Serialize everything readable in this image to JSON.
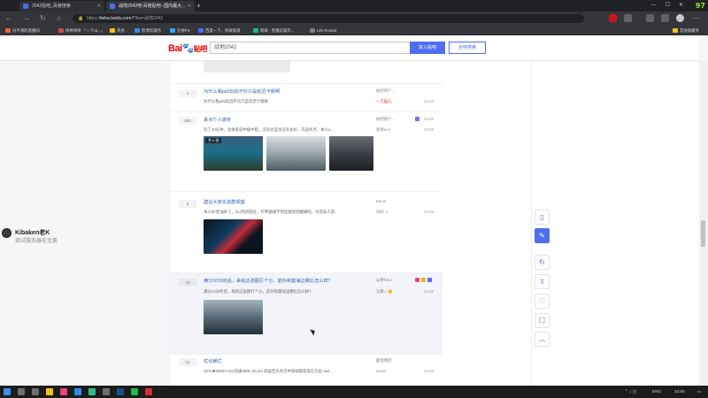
{
  "browser": {
    "tabs": [
      {
        "title": "2042贴吧_百度搜索",
        "active": false
      },
      {
        "title": "战地2042吧-百度贴吧--国内最大...",
        "active": true
      }
    ],
    "fps": "97",
    "url_scheme": "https://",
    "url_host": "tieba.baidu.com",
    "url_path": "/f?kw=战地2042",
    "bookmarks": [
      "份不清的直播间",
      "摔摔摔摔 「一下山...」",
      "英语",
      "智博云操作",
      "在线PS",
      "百度一下，你就知道",
      "新媒 - 直播云操作...",
      "Life Restart"
    ],
    "other_bookmarks": "其他收藏夹"
  },
  "search": {
    "logo_text": "Bai",
    "logo_tb": "贴吧",
    "query": "战地2042",
    "enter_button": "进入贴吧",
    "all_button": "全吧搜索"
  },
  "threads": [
    {
      "replies": "1",
      "title": "为什么我ps5玩战不仅只是延迟卡顿啊",
      "abstract": "为什么我ps5玩战不仅只是延迟卡顿啊",
      "author": "贴吧用户...",
      "last": "一只猫儿",
      "time": "22:48",
      "time2": "22:48"
    },
    {
      "replies": "204",
      "title": "来点个人感受",
      "abstract": "玩了40分钟，总体来说中规中矩，没有太差也没有太好，先说优点，本人2...",
      "author": "贴吧用户...",
      "last": "蛋饼sv♬",
      "time": "22:48",
      "time2": "22:48",
      "thumb_count": "共 4 张"
    },
    {
      "replies": "2",
      "title": "建议大家先进群观望",
      "abstract": "本人8F老油条了，从2到到现在，打死都想不到还能烦到模糊的，幸得多人游...",
      "author": "Kunul",
      "last": "祥纪 ♬",
      "time": "22:48",
      "time2": "22:48"
    },
    {
      "replies": "13",
      "title": "满分10分的话，来给这张图打个分，前外和雷海边哪比怎么样?",
      "abstract": "满分10分的话，来给这张图打个分，前外和雷海边哪比怎么样?",
      "author": "sp胖hai♬",
      "last": "功聚♬🙂",
      "time": "22:48",
      "time2": "22:48"
    },
    {
      "replies": "12",
      "title": "优化稀烂",
      "abstract": "3070✚5900X 8x2双通3600 2K144 高画无论开启中高帧都是低在在右 ops...",
      "author": "翻墙傅团",
      "last": "2xxW",
      "time": "22:48",
      "time2": "22:48"
    }
  ],
  "overlay": {
    "name": "Kibaken老K",
    "subtitle": "测试服务器在北美"
  },
  "taskbar": {
    "lang": "ENG",
    "clock": "22:50"
  }
}
